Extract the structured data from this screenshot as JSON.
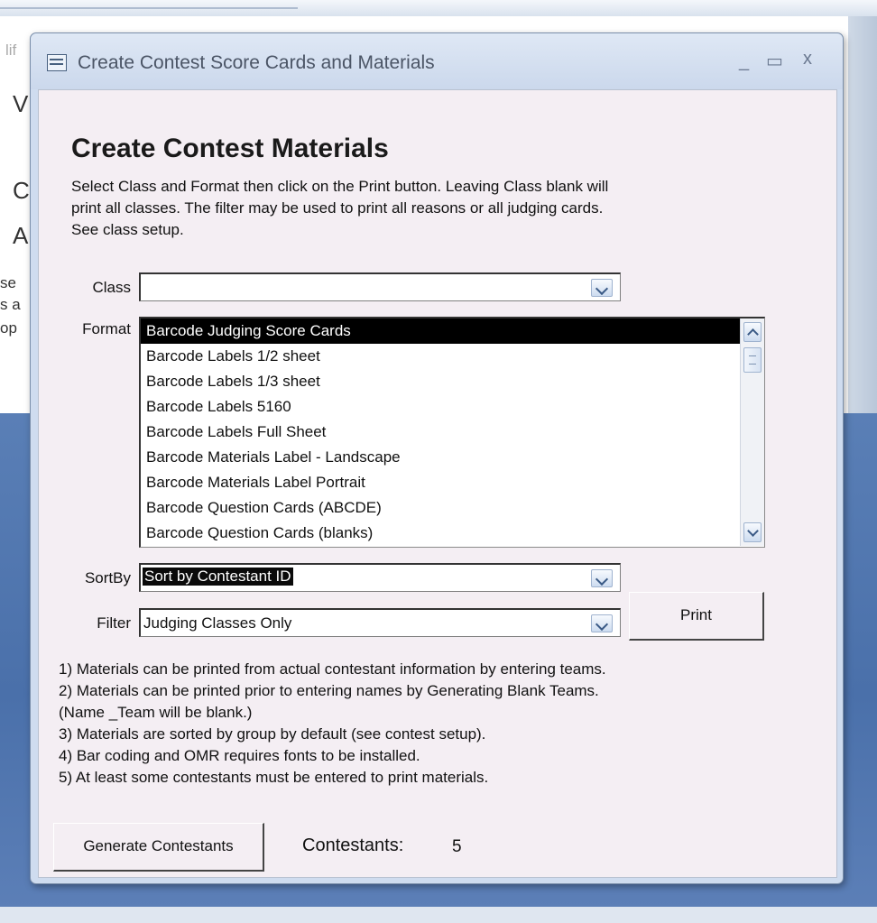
{
  "background": {
    "fragments": [
      "lif",
      "V",
      "C",
      "A",
      "se",
      "s a",
      "op"
    ]
  },
  "window": {
    "title": "Create Contest Score Cards and Materials",
    "controls": {
      "minimize": "_",
      "maximize": "▭",
      "close": "x"
    }
  },
  "form": {
    "heading": "Create Contest Materials",
    "instructions": [
      "Select Class and Format then click on the Print button.  Leaving Class blank will",
      "print all classes.  The filter may be used to print all reasons or all judging cards.",
      "See class setup."
    ],
    "class": {
      "label": "Class",
      "value": ""
    },
    "format": {
      "label": "Format",
      "selected": "Barcode Judging Score Cards",
      "options": [
        "Barcode Judging Score Cards",
        "Barcode Labels 1/2 sheet",
        "Barcode Labels 1/3 sheet",
        "Barcode Labels 5160",
        "Barcode Labels Full Sheet",
        "Barcode Materials Label - Landscape",
        "Barcode Materials Label Portrait",
        "Barcode Question Cards (ABCDE)",
        "Barcode Question Cards (blanks)"
      ]
    },
    "sortby": {
      "label": "SortBy",
      "value": "Sort by Contestant ID"
    },
    "filter": {
      "label": "Filter",
      "value": "Judging Classes Only"
    },
    "print_label": "Print",
    "notes": [
      "1) Materials can be printed from actual contestant information by entering teams.",
      "2) Materials can be printed prior to entering names by Generating Blank Teams.",
      "(Name _Team will be blank.)",
      "3) Materials are sorted by group by default (see contest setup).",
      "4) Bar coding and OMR requires fonts to be installed.",
      "5) At least some contestants must be entered to print materials."
    ],
    "generate_label": "Generate Contestants",
    "contestants": {
      "label": "Contestants:",
      "count": "5"
    }
  },
  "colors": {
    "titlebar": "#cbd8ec",
    "client": "#f4eef3",
    "selection": "#000000"
  }
}
